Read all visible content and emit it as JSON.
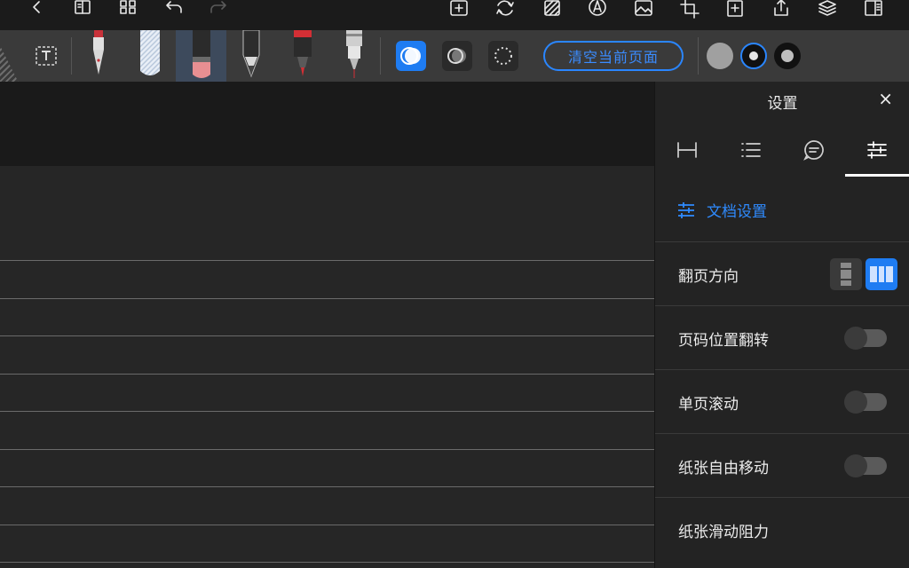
{
  "topbar": {
    "icons": [
      "back-icon",
      "book-icon",
      "grid-icon",
      "undo-icon",
      "redo-icon",
      "add-page-icon",
      "refresh-icon",
      "paper-icon",
      "pen-circle-icon",
      "image-icon",
      "crop-icon",
      "new-doc-icon",
      "share-icon",
      "layers-icon",
      "sidebar-icon"
    ]
  },
  "toolbar": {
    "tools": [
      "text-tool",
      "fountain-pen",
      "highlighter",
      "eraser",
      "pencil",
      "marker",
      "technical-pen"
    ],
    "selected_tool": "eraser",
    "clear_page_label": "清空当前页面",
    "colors": {
      "accent": "#1e7cf2",
      "toolbar_bg": "#3a3a3a"
    }
  },
  "panel": {
    "title": "设置",
    "close_label": "×",
    "tabs": [
      "ruler-icon",
      "list-icon",
      "comment-icon",
      "sliders-icon"
    ],
    "active_tab": "sliders-icon",
    "section_title": "文档设置",
    "rows": [
      {
        "label": "翻页方向",
        "type": "segmented"
      },
      {
        "label": "页码位置翻转",
        "type": "toggle",
        "on": false
      },
      {
        "label": "单页滚动",
        "type": "toggle",
        "on": false
      },
      {
        "label": "纸张自由移动",
        "type": "toggle",
        "on": false
      },
      {
        "label": "纸张滑动阻力",
        "type": "slider"
      }
    ]
  }
}
